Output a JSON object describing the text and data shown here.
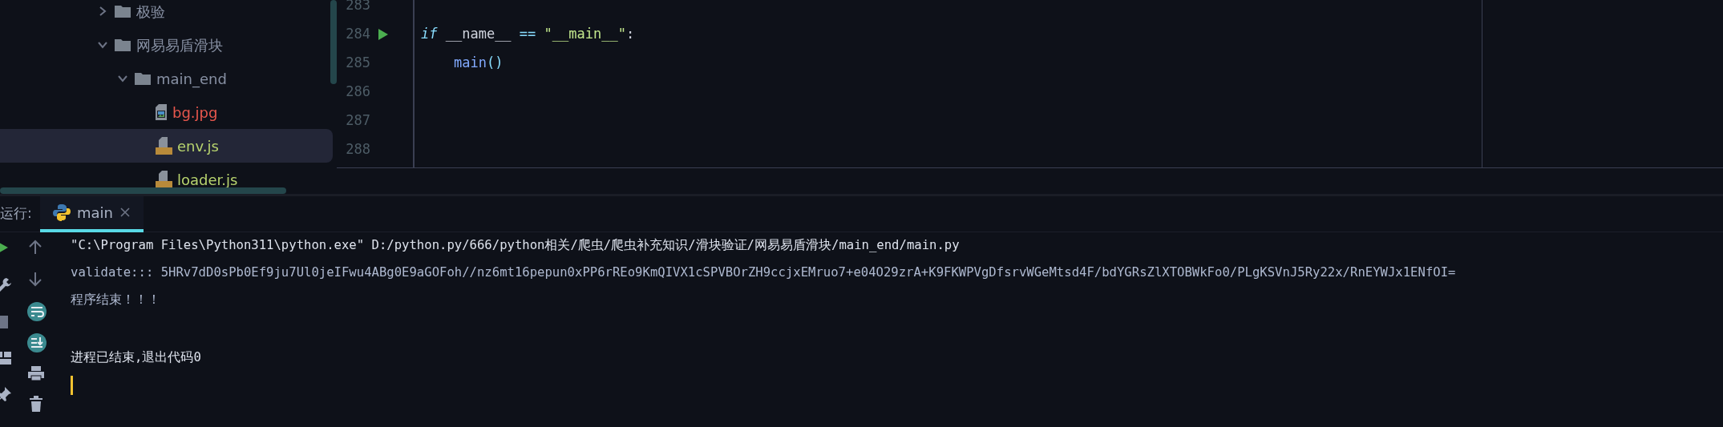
{
  "project_tree": {
    "items": [
      {
        "label": "极验",
        "kind": "folder",
        "expanded": false,
        "selected": false
      },
      {
        "label": "网易易盾滑块",
        "kind": "folder",
        "expanded": true,
        "selected": false,
        "children": [
          {
            "label": "main_end",
            "kind": "folder",
            "expanded": true,
            "selected": false,
            "children": [
              {
                "label": "bg.jpg",
                "kind": "image",
                "selected": false
              },
              {
                "label": "env.js",
                "kind": "js",
                "selected": true
              },
              {
                "label": "loader.js",
                "kind": "js",
                "selected": false
              }
            ]
          }
        ]
      }
    ]
  },
  "editor": {
    "lines": [
      {
        "number": "283",
        "runnable": false
      },
      {
        "number": "284",
        "runnable": true,
        "indented": false,
        "tokens": [
          {
            "text": "if",
            "kind": "keyword"
          },
          {
            "text": " __name__ ",
            "kind": "name"
          },
          {
            "text": "==",
            "kind": "operator"
          },
          {
            "text": " \"__main__\"",
            "kind": "string"
          },
          {
            "text": ":",
            "kind": "name"
          }
        ]
      },
      {
        "number": "285",
        "runnable": false,
        "indented": true,
        "tokens": [
          {
            "text": "main",
            "kind": "call"
          },
          {
            "text": "()",
            "kind": "operator"
          }
        ]
      },
      {
        "number": "286",
        "runnable": false
      },
      {
        "number": "287",
        "runnable": false
      },
      {
        "number": "288",
        "runnable": false
      }
    ]
  },
  "run_panel": {
    "label": "运行:",
    "tabs": [
      {
        "label": "main",
        "selected": true
      }
    ],
    "console_lines": [
      {
        "kind": "command",
        "text": "\"C:\\Program Files\\Python311\\python.exe\" D:/python.py/666/python相关/爬虫/爬虫补充知识/滑块验证/网易易盾滑块/main_end/main.py"
      },
      {
        "kind": "stdout",
        "text": "validate::: 5HRv7dD0sPb0Ef9ju7Ul0jeIFwu4ABg0E9aGOFoh//nz6mt16pepun0xPP6rREo9KmQIVX1cSPVBOrZH9ccjxEMruo7+e04O29zrA+K9FKWPVgDfsrvWGeMtsd4F/bdYGRsZlXTOBWkFo0/PLgKSVnJ5Ry22x/RnEYWJx1ENfOI="
      },
      {
        "kind": "stdout",
        "text": "程序结束！！！"
      },
      {
        "kind": "exit",
        "text": "进程已结束,退出代码0"
      }
    ]
  }
}
